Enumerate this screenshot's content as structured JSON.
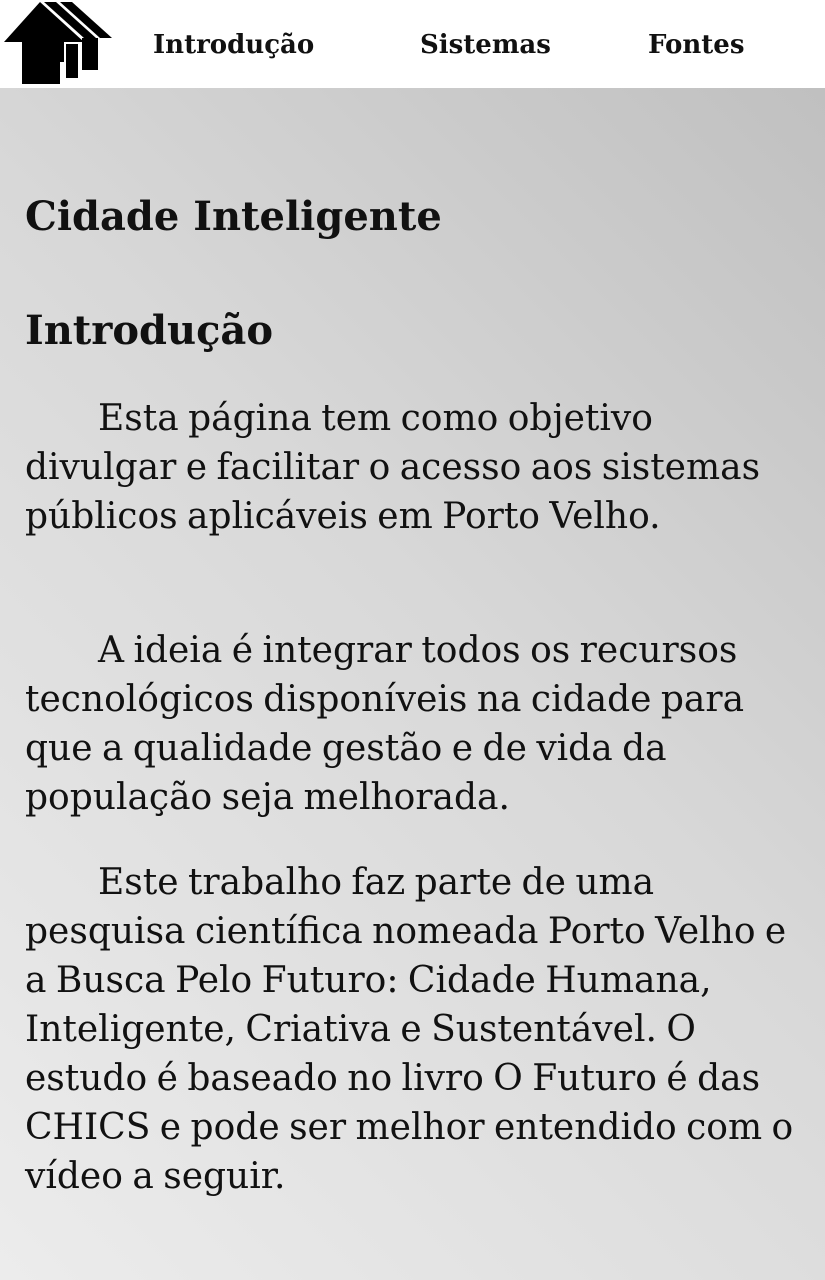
{
  "nav": {
    "items": [
      {
        "label": "Introdução"
      },
      {
        "label": "Sistemas"
      },
      {
        "label": "Fontes"
      }
    ],
    "logo_icon": "houses-logo-icon"
  },
  "main": {
    "site_title": "Cidade Inteligente",
    "section_title": "Introdução",
    "paragraphs": [
      "Esta página tem como objetivo divulgar e facilitar o acesso aos sistemas públicos aplicáveis em Porto Velho.",
      "A ideia é integrar todos os recursos tecnológicos disponíveis na cidade para que a qualidade gestão e de vida da população seja melhorada.",
      "Este trabalho faz parte de uma pesquisa científica nomeada Porto Velho e a Busca Pelo Futuro: Cidade Humana, Inteligente, Criativa e Sustentável. O estudo é baseado no livro O Futuro é das CHICS e pode ser melhor entendido com o vídeo a seguir."
    ]
  },
  "colors": {
    "nav_background": "#ffffff",
    "text": "#111111",
    "content_gradient_light": "#ececec",
    "content_gradient_dark": "#c0c0c0"
  }
}
